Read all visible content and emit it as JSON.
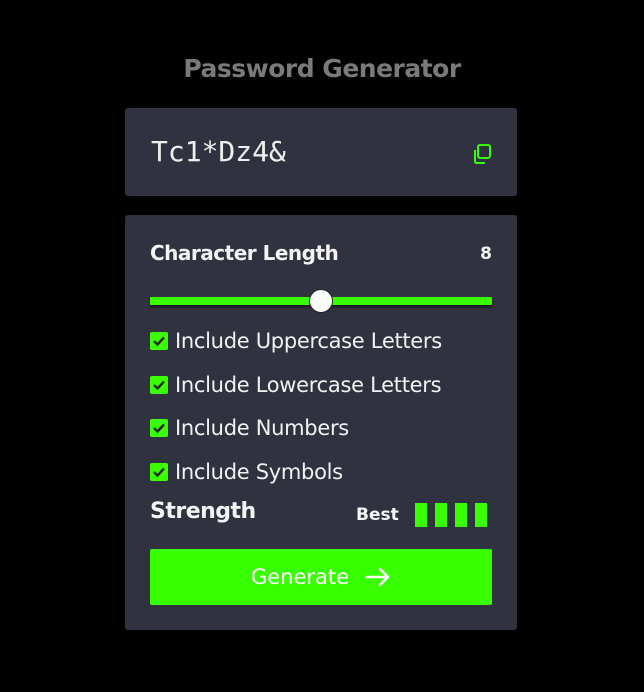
{
  "app": {
    "title": "Password Generator"
  },
  "output": {
    "password": "Tc1*Dz4&",
    "copy_icon": "copy-icon"
  },
  "settings": {
    "length_label": "Character Length",
    "length_value": "8",
    "length_slider": {
      "min": 0,
      "max": 16,
      "value": 8
    },
    "options": [
      {
        "label": "Include Uppercase Letters",
        "checked": true
      },
      {
        "label": "Include Lowercase Letters",
        "checked": true
      },
      {
        "label": "Include Numbers",
        "checked": true
      },
      {
        "label": "Include Symbols",
        "checked": true
      }
    ],
    "strength_label": "Strength",
    "strength_value": "Best",
    "strength_level": 4,
    "strength_max": 4,
    "generate_label": "Generate",
    "generate_icon": "arrow-right-icon"
  },
  "colors": {
    "background": "#000000",
    "card": "#30333f",
    "accent": "#38ff00",
    "title": "#7a7a7a",
    "text": "#f5f5f5"
  }
}
